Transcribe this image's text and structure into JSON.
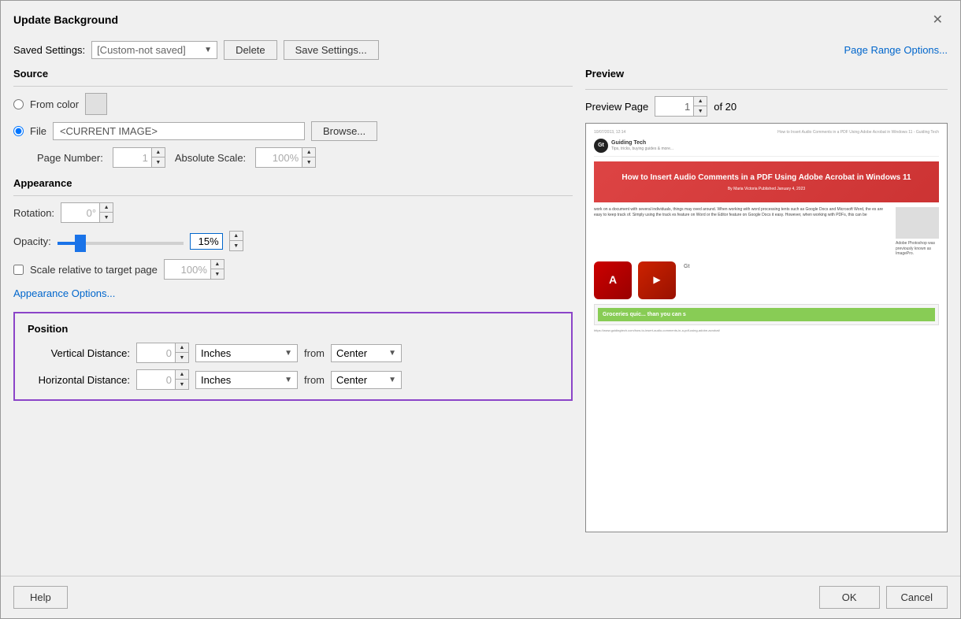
{
  "dialog": {
    "title": "Update Background",
    "close_label": "✕"
  },
  "topbar": {
    "saved_settings_label": "Saved Settings:",
    "saved_settings_value": "[Custom-not saved]",
    "delete_label": "Delete",
    "save_settings_label": "Save Settings...",
    "page_range_label": "Page Range Options..."
  },
  "source": {
    "title": "Source",
    "from_color_label": "From color",
    "file_label": "File",
    "file_value": "<CURRENT IMAGE>",
    "browse_label": "Browse...",
    "page_number_label": "Page Number:",
    "page_number_value": "1",
    "absolute_scale_label": "Absolute Scale:",
    "absolute_scale_value": "100%"
  },
  "appearance": {
    "title": "Appearance",
    "rotation_label": "Rotation:",
    "rotation_value": "0°",
    "opacity_label": "Opacity:",
    "opacity_value": "15%",
    "opacity_percent": 15,
    "scale_label": "Scale relative to target page",
    "scale_value": "100%",
    "options_link": "Appearance Options..."
  },
  "position": {
    "title": "Position",
    "vertical_label": "Vertical Distance:",
    "vertical_value": "0",
    "vertical_unit": "Inches",
    "vertical_from": "from",
    "vertical_position": "Center",
    "horizontal_label": "Horizontal Distance:",
    "horizontal_value": "0",
    "horizontal_unit": "Inches",
    "horizontal_from": "from",
    "horizontal_position": "Center"
  },
  "preview": {
    "title": "Preview",
    "page_label": "Preview Page",
    "page_value": "1",
    "of_label": "of 20",
    "article": {
      "date": "10/07/2013, 12:14",
      "title_link": "How to Insert Audio Comments in a PDF Using Adobe Acrobat in Windows 11 - Guiding Tech",
      "site_name": "Guiding Tech",
      "tagline": "Tips, tricks, buying guides & more...",
      "hero_title": "How to Insert Audio Comments in a PDF Using Adobe Acrobat in Windows 11",
      "author": "By Maria Victoria  Published January 4, 2023",
      "body_text": "work on a document with several individuals, things may oved around. When working with word processing tents such as Google Docs and Microsoft Word, the es are easy to keep track of. Simply using the track es feature on Word or the Editor feature on Google Docs it easy. However, when working with PDFs, this can be",
      "aside_text": "Adobe Photoshop was previously known as ImagePro.",
      "ad_text": "Groceries quic... than you can s",
      "url": "https://www.guidingtech.com/how-to-insert-audio-comments-in-a-pdf-using-adobe-acrobat/"
    }
  },
  "footer": {
    "help_label": "Help",
    "ok_label": "OK",
    "cancel_label": "Cancel"
  }
}
